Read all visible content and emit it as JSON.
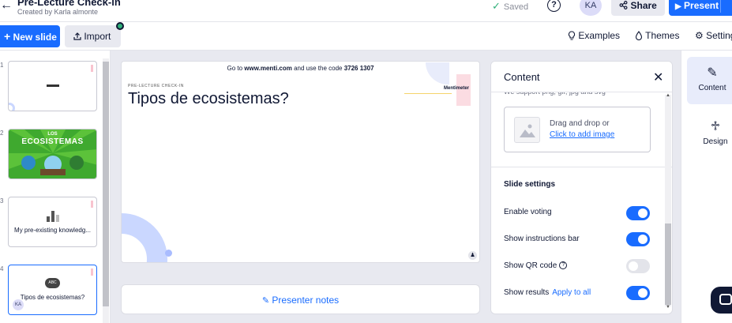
{
  "header": {
    "title": "Pre-Lecture Check-in",
    "subtitle": "Created by Karla almonte",
    "saved_label": "Saved",
    "help_label": "?",
    "avatar_initials": "KA",
    "share_label": "Share",
    "present_label": "Present"
  },
  "toolbar": {
    "new_slide_label": "New slide",
    "import_label": "Import",
    "examples_label": "Examples",
    "themes_label": "Themes",
    "settings_label": "Settings"
  },
  "slides": [
    {
      "number": "1",
      "caption": ""
    },
    {
      "number": "2",
      "caption": "",
      "image_title_1": "LOS",
      "image_title_2": "ECOSISTEMAS"
    },
    {
      "number": "3",
      "caption": "My pre-existing knowledg..."
    },
    {
      "number": "4",
      "caption": "Tipos de ecosistemas?",
      "badge": "ABC",
      "avatar": "KA"
    }
  ],
  "canvas": {
    "code_prefix": "Go to ",
    "code_site": "www.menti.com",
    "code_middle": " and use the code ",
    "code_value": "3726 1307",
    "tag": "PRE-LECTURE CHECK-IN",
    "heading": "Tipos de ecosistemas?",
    "brand": "Mentimeter"
  },
  "notes": {
    "label": "Presenter notes"
  },
  "panel": {
    "title": "Content",
    "support_text": "We support png, gif, jpg and svg",
    "drop_text": "Drag and drop or",
    "add_image_link": "Click to add image",
    "slide_settings_title": "Slide settings",
    "settings": [
      {
        "label": "Enable voting",
        "on": true
      },
      {
        "label": "Show instructions bar",
        "on": true
      },
      {
        "label": "Show QR code",
        "on": false
      },
      {
        "label": "Show results",
        "link": "Apply to all",
        "on": true
      }
    ]
  },
  "rail": {
    "content_label": "Content",
    "design_label": "Design"
  },
  "colors": {
    "accent": "#196cff",
    "success": "#2fb079",
    "text": "#101834"
  }
}
